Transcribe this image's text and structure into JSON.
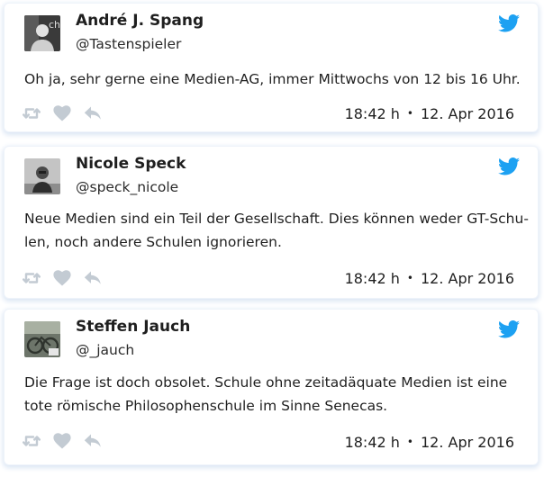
{
  "colors": {
    "twitter_blue": "#1da1f2",
    "action_gray": "#c3cbd3",
    "text": "#1f1f1f",
    "card_shadow": "#dbe6f4"
  },
  "icons": {
    "brand": "twitter-bird-icon",
    "actions": [
      "retweet-icon",
      "heart-icon",
      "reply-icon"
    ]
  },
  "tweets": [
    {
      "name": "André J. Spang",
      "handle": "@Tastenspieler",
      "text_lines": [
        "Oh ja, sehr gerne eine Medien-AG, immer Mittwochs von 12 bis 16 Uhr."
      ],
      "time": "18:42 h",
      "date": "12. Apr 2016"
    },
    {
      "name": "Nicole Speck",
      "handle": "@speck_nicole",
      "text_lines": [
        "Neue Medien sind ein Teil der Gesellschaft. Dies können weder GT-Schu-",
        "len, noch andere Schulen ignorieren."
      ],
      "time": "18:42 h",
      "date": "12. Apr 2016"
    },
    {
      "name": "Steffen Jauch",
      "handle": "@_jauch",
      "text_lines": [
        "Die Frage ist doch obsolet. Schule ohne zeitadäquate Medien ist eine",
        "tote römische Philosophenschule im Sinne Senecas."
      ],
      "time": "18:42 h",
      "date": "12. Apr 2016"
    }
  ]
}
